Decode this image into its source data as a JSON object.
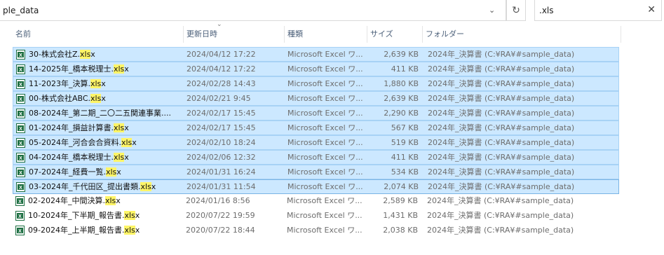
{
  "address": {
    "path": "ple_data"
  },
  "search": {
    "query": ".xls"
  },
  "columns": {
    "name": "名前",
    "date": "更新日時",
    "type": "種類",
    "size": "サイズ",
    "folder": "フォルダー"
  },
  "files": [
    {
      "pre": "30-株式会社Z.",
      "hl": "xls",
      "post": "x",
      "date": "2024/04/12 17:22",
      "type": "Microsoft Excel ワ...",
      "size": "2,639 KB",
      "folder": "2024年_決算書 (C:¥RA¥#sample_data)",
      "selected": true
    },
    {
      "pre": "14-2025年_橋本税理士.",
      "hl": "xls",
      "post": "x",
      "date": "2024/04/12 17:22",
      "type": "Microsoft Excel ワ...",
      "size": "411 KB",
      "folder": "2024年_決算書 (C:¥RA¥#sample_data)",
      "selected": true
    },
    {
      "pre": "11-2023年_決算.",
      "hl": "xls",
      "post": "x",
      "date": "2024/02/28 14:43",
      "type": "Microsoft Excel ワ...",
      "size": "1,880 KB",
      "folder": "2024年_決算書 (C:¥RA¥#sample_data)",
      "selected": true
    },
    {
      "pre": "00-株式会社ABC.",
      "hl": "xls",
      "post": "x",
      "date": "2024/02/21 9:45",
      "type": "Microsoft Excel ワ...",
      "size": "2,639 KB",
      "folder": "2024年_決算書 (C:¥RA¥#sample_data)",
      "selected": true
    },
    {
      "pre": "08-2024年_第二期_二〇二五関連事業....",
      "hl": "",
      "post": "",
      "date": "2024/02/17 15:45",
      "type": "Microsoft Excel ワ...",
      "size": "2,290 KB",
      "folder": "2024年_決算書 (C:¥RA¥#sample_data)",
      "selected": true
    },
    {
      "pre": "01-2024年_損益計算書.",
      "hl": "xls",
      "post": "x",
      "date": "2024/02/17 15:45",
      "type": "Microsoft Excel ワ...",
      "size": "567 KB",
      "folder": "2024年_決算書 (C:¥RA¥#sample_data)",
      "selected": true
    },
    {
      "pre": "05-2024年_河合会合資料.",
      "hl": "xls",
      "post": "x",
      "date": "2024/02/10 18:24",
      "type": "Microsoft Excel ワ...",
      "size": "519 KB",
      "folder": "2024年_決算書 (C:¥RA¥#sample_data)",
      "selected": true
    },
    {
      "pre": "04-2024年_橋本税理士.",
      "hl": "xls",
      "post": "x",
      "date": "2024/02/06 12:32",
      "type": "Microsoft Excel ワ...",
      "size": "411 KB",
      "folder": "2024年_決算書 (C:¥RA¥#sample_data)",
      "selected": true
    },
    {
      "pre": "07-2024年_経費一覧.",
      "hl": "xls",
      "post": "x",
      "date": "2024/01/31 16:24",
      "type": "Microsoft Excel ワ...",
      "size": "534 KB",
      "folder": "2024年_決算書 (C:¥RA¥#sample_data)",
      "selected": true
    },
    {
      "pre": "03-2024年_千代田区_提出書類.",
      "hl": "xls",
      "post": "x",
      "date": "2024/01/31 11:54",
      "type": "Microsoft Excel ワ...",
      "size": "2,074 KB",
      "folder": "2024年_決算書 (C:¥RA¥#sample_data)",
      "selected": true
    },
    {
      "pre": "02-2024年_中間決算.",
      "hl": "xls",
      "post": "x",
      "date": "2024/01/16 8:56",
      "type": "Microsoft Excel ワ...",
      "size": "2,589 KB",
      "folder": "2024年_決算書 (C:¥RA¥#sample_data)",
      "selected": false
    },
    {
      "pre": "10-2024年_下半期_報告書.",
      "hl": "xls",
      "post": "x",
      "date": "2020/07/22 19:59",
      "type": "Microsoft Excel ワ...",
      "size": "1,431 KB",
      "folder": "2024年_決算書 (C:¥RA¥#sample_data)",
      "selected": false
    },
    {
      "pre": "09-2024年_上半期_報告書.",
      "hl": "xls",
      "post": "x",
      "date": "2020/07/22 18:44",
      "type": "Microsoft Excel ワ...",
      "size": "2,038 KB",
      "folder": "2024年_決算書 (C:¥RA¥#sample_data)",
      "selected": false
    }
  ]
}
